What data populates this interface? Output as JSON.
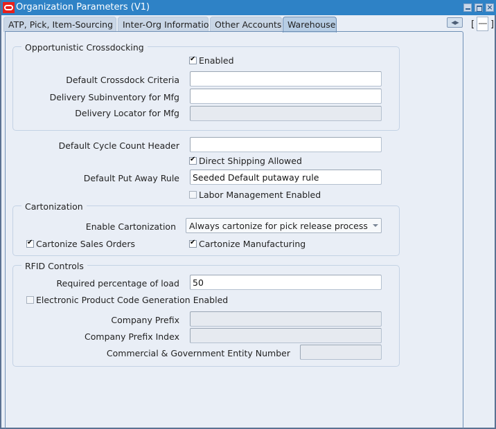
{
  "window": {
    "title": "Organization Parameters (V1)",
    "controls": {
      "minimize": "minimize-icon",
      "maximize": "maximize-icon",
      "close": "close-icon"
    }
  },
  "tabs": [
    {
      "label": "ATP, Pick, Item-Sourcing",
      "active": false
    },
    {
      "label": "Inter-Org Information",
      "active": false
    },
    {
      "label": "Other Accounts",
      "active": false
    },
    {
      "label": "Warehouse",
      "active": true
    }
  ],
  "tab_nav": {
    "arrows_icon": "left-right-arrows-icon",
    "bracket_open": "[",
    "bracket_close": "]",
    "indicator": "----"
  },
  "crossdocking": {
    "title": "Opportunistic Crossdocking",
    "enabled": {
      "label": "Enabled",
      "checked": true
    },
    "default_criteria": {
      "label": "Default Crossdock Criteria",
      "value": ""
    },
    "delivery_subinventory": {
      "label": "Delivery Subinventory for Mfg",
      "value": ""
    },
    "delivery_locator": {
      "label": "Delivery Locator for Mfg",
      "value": "",
      "disabled": true
    }
  },
  "general": {
    "cycle_count_header": {
      "label": "Default Cycle Count Header",
      "value": ""
    },
    "direct_shipping": {
      "label": "Direct Shipping Allowed",
      "checked": true
    },
    "put_away_rule": {
      "label": "Default Put Away Rule",
      "value": "Seeded Default putaway rule"
    },
    "labor_management": {
      "label": "Labor Management Enabled",
      "checked": false
    }
  },
  "cartonization": {
    "title": "Cartonization",
    "enable": {
      "label": "Enable Cartonization",
      "value": "Always cartonize for pick release process"
    },
    "sales_orders": {
      "label": "Cartonize Sales Orders",
      "checked": true
    },
    "manufacturing": {
      "label": "Cartonize Manufacturing",
      "checked": true
    }
  },
  "rfid": {
    "title": "RFID Controls",
    "required_percentage": {
      "label": "Required percentage of load",
      "value": "50"
    },
    "epc_generation": {
      "label": "Electronic Product Code Generation Enabled",
      "checked": false
    },
    "company_prefix": {
      "label": "Company Prefix",
      "value": "",
      "disabled": true
    },
    "company_prefix_index": {
      "label": "Company Prefix Index",
      "value": "",
      "disabled": true
    },
    "cage_number": {
      "label": "Commercial & Government Entity Number",
      "value": "",
      "disabled": true
    }
  }
}
